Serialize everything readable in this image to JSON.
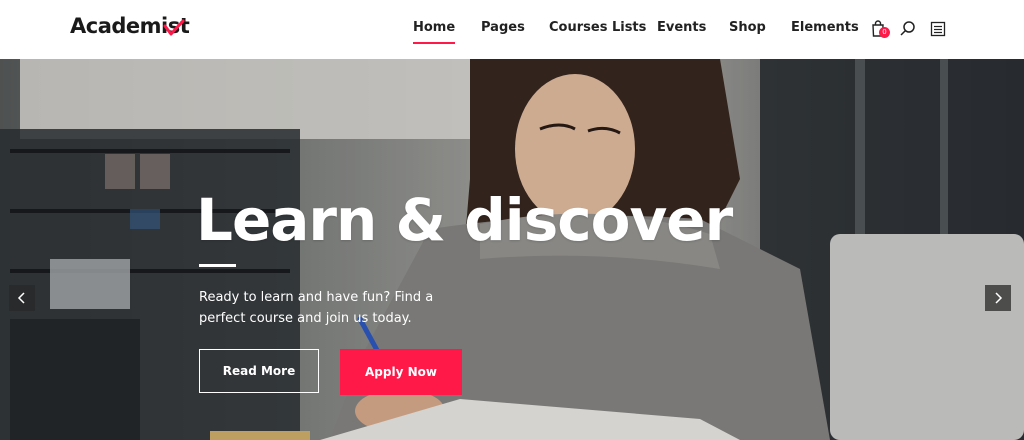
{
  "brand": {
    "name": "Academist",
    "accent": "#ff1949"
  },
  "nav": {
    "items": [
      {
        "label": "Home",
        "active": true
      },
      {
        "label": "Pages"
      },
      {
        "label": "Courses Lists"
      },
      {
        "label": "Events"
      },
      {
        "label": "Shop"
      },
      {
        "label": "Elements"
      }
    ],
    "cart_count": "0",
    "icons": [
      "shopping-bag-icon",
      "search-icon",
      "menu-list-icon"
    ]
  },
  "hero": {
    "headline": "Learn & discover",
    "subtext": "Ready to learn and have fun? Find a perfect course and join us today.",
    "read_more": "Read More",
    "apply_now": "Apply Now",
    "prev_icon": "chevron-left-icon",
    "next_icon": "chevron-right-icon"
  }
}
